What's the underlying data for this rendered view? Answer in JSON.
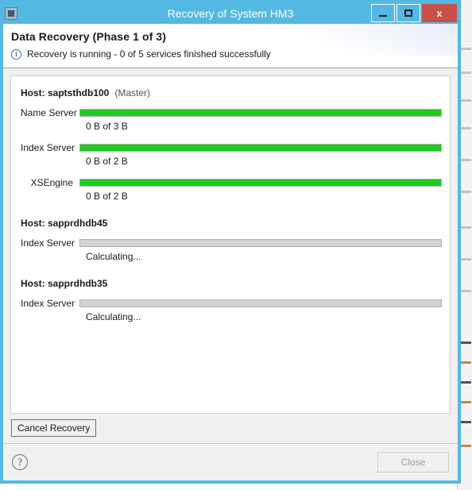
{
  "window": {
    "title": "Recovery of System HM3",
    "icon": "application-icon",
    "controls": {
      "minimize_label": "–",
      "maximize_label": "□",
      "close_label": "x"
    },
    "accent_color": "#54b9e2",
    "close_color": "#c7514a"
  },
  "header": {
    "title": "Data Recovery (Phase 1 of 3)",
    "status_icon": "info-icon",
    "status_glyph": "i",
    "status_text": "Recovery is running - 0 of 5 services finished successfully"
  },
  "progress_color": "#1fcb1f",
  "idle_color": "#d4d4d4",
  "hosts": [
    {
      "label": "Host: saptsthdb100",
      "role": "(Master)",
      "services": [
        {
          "name": "Name Server",
          "detail": "0 B of 3 B",
          "percent": 100,
          "state": "running"
        },
        {
          "name": "Index Server",
          "detail": "0 B of 2 B",
          "percent": 100,
          "state": "running"
        },
        {
          "name": "XSEngine",
          "detail": "0 B of 2 B",
          "percent": 100,
          "state": "running"
        }
      ]
    },
    {
      "label": "Host: sapprdhdb45",
      "role": "",
      "services": [
        {
          "name": "Index Server",
          "detail": "Calculating...",
          "percent": 0,
          "state": "idle"
        }
      ]
    },
    {
      "label": "Host: sapprdhdb35",
      "role": "",
      "services": [
        {
          "name": "Index Server",
          "detail": "Calculating...",
          "percent": 0,
          "state": "idle"
        }
      ]
    }
  ],
  "actions": {
    "cancel_label": "Cancel Recovery",
    "help_glyph": "?",
    "close_label": "Close",
    "close_enabled": false
  }
}
